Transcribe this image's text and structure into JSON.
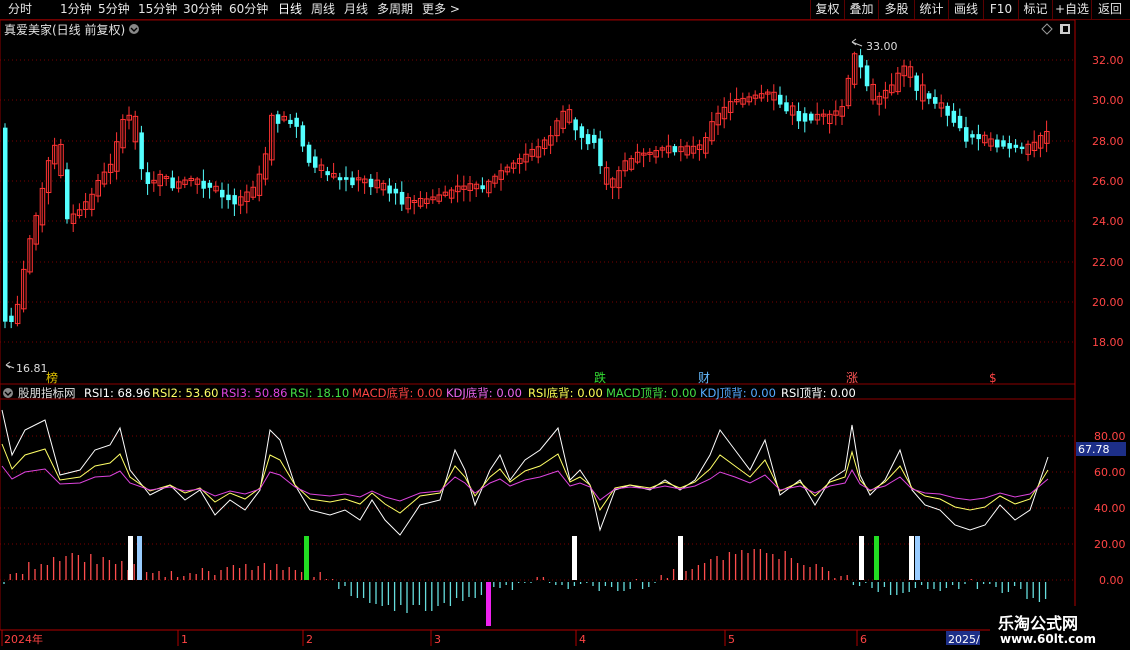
{
  "toolbar": {
    "periods": [
      "分时",
      "1分钟",
      "5分钟",
      "15分钟",
      "30分钟",
      "60分钟",
      "日线",
      "周线",
      "月线",
      "多周期",
      "更多"
    ],
    "more_arrow": ">",
    "right_buttons": [
      "复权",
      "叠加",
      "多股",
      "统计",
      "画线",
      "F10",
      "标记",
      "+自选",
      "返回"
    ]
  },
  "main_chart": {
    "title": "真爱美家(日线 前复权)",
    "high_label": "33.00",
    "low_label": "16.81",
    "y_ticks": [
      "32.00",
      "30.00",
      "28.00",
      "26.00",
      "24.00",
      "22.00",
      "20.00",
      "18.00"
    ],
    "event_markers": [
      {
        "text": "榜",
        "color": "#e0c000"
      },
      {
        "text": "跌",
        "color": "#33dd33"
      },
      {
        "text": "财",
        "color": "#66bbff"
      },
      {
        "text": "涨",
        "color": "#ff5555"
      },
      {
        "text": "$",
        "color": "#ff4444"
      }
    ]
  },
  "indicator": {
    "name": "股朋指标网",
    "values": [
      {
        "label": "RSI1: 68.96",
        "color": "#ffffff"
      },
      {
        "label": "RSI2: 53.60",
        "color": "#ffff66"
      },
      {
        "label": "RSI3: 50.86",
        "color": "#dd44dd"
      },
      {
        "label": "RSI: 18.10",
        "color": "#44dd44"
      },
      {
        "label": "MACD底背: 0.00",
        "color": "#ff4444"
      },
      {
        "label": "KDJ底背: 0.00",
        "color": "#ee66ee"
      },
      {
        "label": "RSI底背: 0.00",
        "color": "#ffff55"
      },
      {
        "label": "MACD顶背: 0.00",
        "color": "#44dd44"
      },
      {
        "label": "KDJ顶背: 0.00",
        "color": "#55aaff"
      },
      {
        "label": "RSI顶背: 0.00",
        "color": "#ffffff"
      }
    ],
    "y_ticks": [
      "80.00",
      "60.00",
      "40.00",
      "20.00",
      "0.00"
    ],
    "current_value": "67.78"
  },
  "x_axis": {
    "labels": [
      "2024年",
      "1",
      "2",
      "3",
      "4",
      "5",
      "6",
      "2025/"
    ]
  },
  "watermark": {
    "title": "乐淘公式网",
    "url": "www.60lt.com"
  },
  "colors": {
    "up": "#ff3333",
    "down": "#54ffff",
    "grid": "#8b0000",
    "axis_text": "#ff4444"
  }
}
